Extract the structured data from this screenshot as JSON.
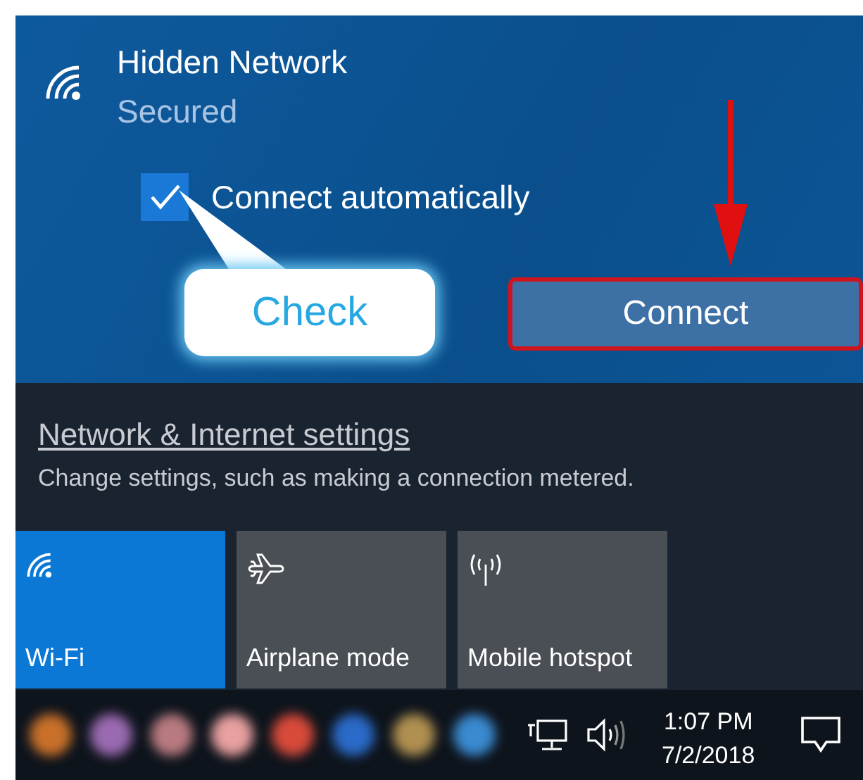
{
  "network": {
    "name": "Hidden Network",
    "status": "Secured",
    "connect_automatically": {
      "label": "Connect automatically",
      "checked": true
    },
    "connect_button": "Connect"
  },
  "annotations": {
    "callout": "Check",
    "arrow": true,
    "highlight_connect": true
  },
  "settings": {
    "link": "Network & Internet settings",
    "description": "Change settings, such as making a connection metered."
  },
  "quick_actions": [
    {
      "kind": "wifi",
      "label": "Wi-Fi",
      "selected": true
    },
    {
      "kind": "airplane",
      "label": "Airplane mode",
      "selected": false
    },
    {
      "kind": "hotspot",
      "label": "Mobile hotspot",
      "selected": false
    }
  ],
  "taskbar": {
    "apps": [
      {
        "color": "#c8702a"
      },
      {
        "color": "#9a6ab0"
      },
      {
        "color": "#b87a80"
      },
      {
        "color": "#e8a0a0"
      },
      {
        "color": "#d84a3a"
      },
      {
        "color": "#2a6ac8"
      },
      {
        "color": "#b09050"
      },
      {
        "color": "#3a8ad0"
      }
    ],
    "time": "1:07 PM",
    "date": "7/2/2018"
  }
}
